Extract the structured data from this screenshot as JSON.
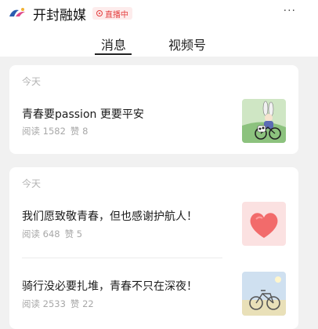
{
  "header": {
    "app_name": "开封融媒",
    "live_badge": "直播中",
    "more_label": "···"
  },
  "tabs": [
    {
      "label": "消息",
      "active": true
    },
    {
      "label": "视频号",
      "active": false
    }
  ],
  "feed": [
    {
      "date": "今天",
      "articles": [
        {
          "title": "青春要passion 更要平安",
          "reads_label": "阅读 1582",
          "likes_label": "赞 8",
          "thumbnail": "cartoon-cyclist-illustration"
        }
      ]
    },
    {
      "date": "今天",
      "articles": [
        {
          "title": "我们愿致敬青春，但也感谢护航人！",
          "reads_label": "阅读 648",
          "likes_label": "赞 5",
          "thumbnail": "pink-heart-graphic"
        },
        {
          "title": "骑行没必要扎堆，青春不只在深夜！",
          "reads_label": "阅读 2533",
          "likes_label": "赞 22",
          "thumbnail": "bicycle-photo"
        }
      ]
    }
  ],
  "colors": {
    "live_red": "#e43f3f",
    "meta_gray": "#a8a8a8",
    "background": "#f1f1f1"
  }
}
